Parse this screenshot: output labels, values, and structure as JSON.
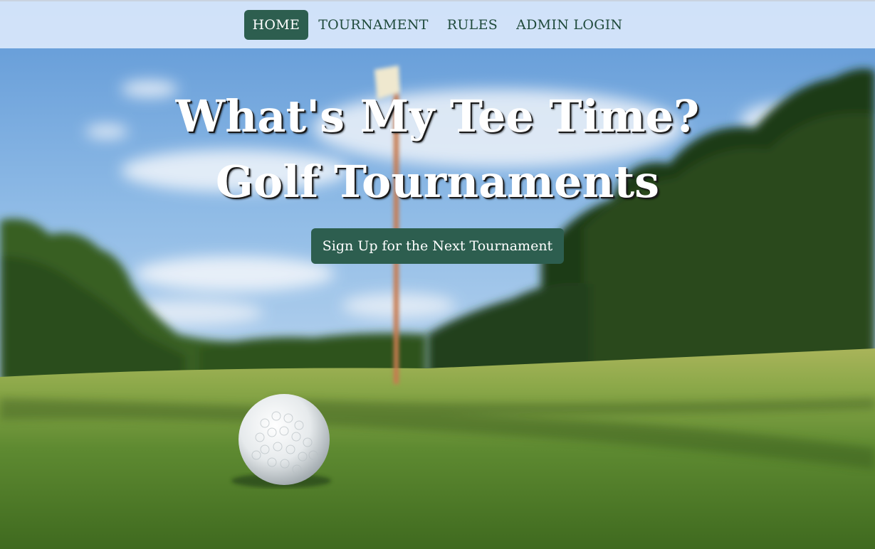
{
  "nav": {
    "items": [
      {
        "label": "HOME",
        "active": true
      },
      {
        "label": "TOURNAMENT",
        "active": false
      },
      {
        "label": "RULES",
        "active": false
      },
      {
        "label": "ADMIN LOGIN",
        "active": false
      }
    ]
  },
  "hero": {
    "title_line1": "What's My Tee Time?",
    "title_line2": "Golf Tournaments",
    "cta_label": "Sign Up for the Next Tournament"
  },
  "background": {
    "description_icon": "golf-course-photo"
  },
  "colors": {
    "brand_green": "#2d5e4f",
    "nav_background": "#dae8fc",
    "nav_text": "#1f4a3b"
  }
}
